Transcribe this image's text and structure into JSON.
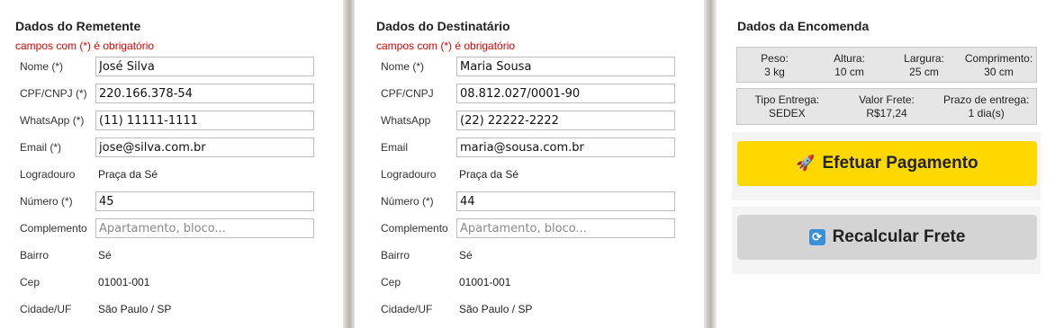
{
  "remetente": {
    "title": "Dados do Remetente",
    "required_note": "campos com (*) é obrigatório",
    "fields": [
      {
        "label": "Nome (*)",
        "value": "José Silva"
      },
      {
        "label": "CPF/CNPJ (*)",
        "value": "220.166.378-54"
      },
      {
        "label": "WhatsApp (*)",
        "value": "(11) 11111-1111"
      },
      {
        "label": "Email (*)",
        "value": "jose@silva.com.br"
      },
      {
        "label": "Logradouro",
        "value": "Praça da Sé"
      },
      {
        "label": "Número (*)",
        "value": "45"
      },
      {
        "label": "Complemento",
        "value": "",
        "placeholder": "Apartamento, bloco..."
      },
      {
        "label": "Bairro",
        "value": "Sé"
      },
      {
        "label": "Cep",
        "value": "01001-001"
      },
      {
        "label": "Cidade/UF",
        "value": "São Paulo / SP"
      }
    ]
  },
  "destinatario": {
    "title": "Dados do Destinatário",
    "required_note": "campos com (*) é obrigatório",
    "fields": [
      {
        "label": "Nome (*)",
        "value": "Maria Sousa"
      },
      {
        "label": "CPF/CNPJ",
        "value": "08.812.027/0001-90"
      },
      {
        "label": "WhatsApp",
        "value": "(22) 22222-2222"
      },
      {
        "label": "Email",
        "value": "maria@sousa.com.br"
      },
      {
        "label": "Logradouro",
        "value": "Praça da Sé"
      },
      {
        "label": "Número (*)",
        "value": "44"
      },
      {
        "label": "Complemento",
        "value": "",
        "placeholder": "Apartamento, bloco..."
      },
      {
        "label": "Bairro",
        "value": "Sé"
      },
      {
        "label": "Cep",
        "value": "01001-001"
      },
      {
        "label": "Cidade/UF",
        "value": "São Paulo / SP"
      }
    ]
  },
  "encomenda": {
    "title": "Dados da Encomenda",
    "dimensions": [
      {
        "label": "Peso:",
        "value": "3 kg"
      },
      {
        "label": "Altura:",
        "value": "10 cm"
      },
      {
        "label": "Largura:",
        "value": "25 cm"
      },
      {
        "label": "Comprimento:",
        "value": "30 cm"
      }
    ],
    "shipping": [
      {
        "label": "Tipo Entrega:",
        "value": "SEDEX"
      },
      {
        "label": "Valor Frete:",
        "value": "R$17,24"
      },
      {
        "label": "Prazo de entrega:",
        "value": "1 dia(s)"
      }
    ],
    "pay_button": {
      "label": "Efetuar Pagamento",
      "icon": "rocket-icon",
      "glyph": "🚀",
      "color": "#ffd800"
    },
    "recalc_button": {
      "label": "Recalcular Frete",
      "icon": "refresh-icon",
      "glyph": "⟳",
      "color": "#d4d4d4"
    }
  }
}
